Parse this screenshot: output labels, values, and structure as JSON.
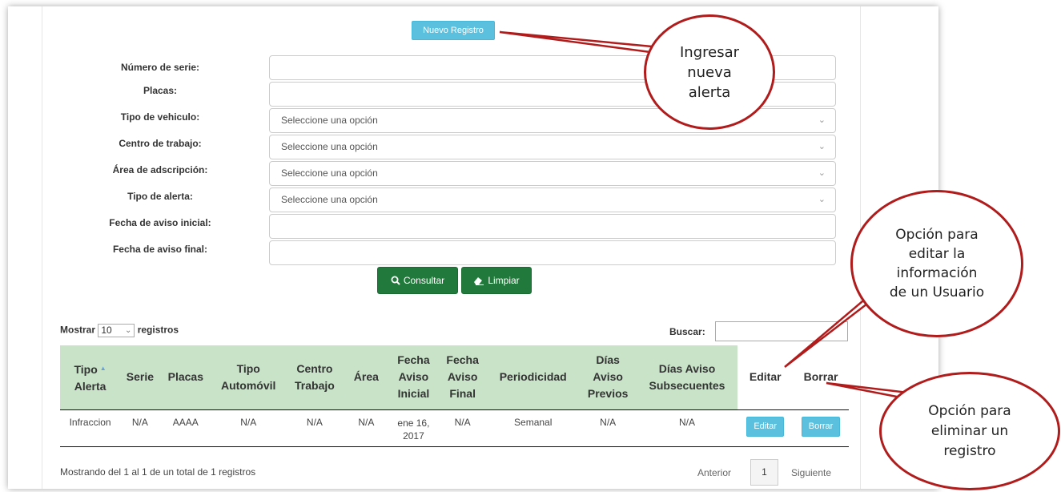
{
  "header": {
    "new_button": "Nuevo Registro"
  },
  "form": {
    "fields": [
      {
        "label": "Número de serie:",
        "type": "text",
        "value": ""
      },
      {
        "label": "Placas:",
        "type": "text",
        "value": ""
      },
      {
        "label": "Tipo de vehiculo:",
        "type": "select",
        "value": "Seleccione una opción"
      },
      {
        "label": "Centro de trabajo:",
        "type": "select",
        "value": "Seleccione una opción"
      },
      {
        "label": "Área de adscripción:",
        "type": "select",
        "value": "Seleccione una opción"
      },
      {
        "label": "Tipo de alerta:",
        "type": "select",
        "value": "Seleccione una opción"
      },
      {
        "label": "Fecha de aviso inicial:",
        "type": "text",
        "value": ""
      },
      {
        "label": "Fecha de aviso final:",
        "type": "text",
        "value": ""
      }
    ],
    "consult_label": "Consultar",
    "clear_label": "Limpiar"
  },
  "table_controls": {
    "show_prefix": "Mostrar",
    "length_value": "10",
    "show_suffix": "registros",
    "search_label": "Buscar:"
  },
  "table": {
    "columns": [
      [
        "Tipo",
        "Alerta"
      ],
      [
        "Serie"
      ],
      [
        "Placas"
      ],
      [
        "Tipo",
        "Automóvil"
      ],
      [
        "Centro",
        "Trabajo"
      ],
      [
        "Área"
      ],
      [
        "Fecha",
        "Aviso",
        "Inicial"
      ],
      [
        "Fecha",
        "Aviso",
        "Final"
      ],
      [
        "Periodicidad"
      ],
      [
        "Días",
        "Aviso",
        "Previos"
      ],
      [
        "Días Aviso",
        "Subsecuentes"
      ],
      [
        "Editar"
      ],
      [
        "Borrar"
      ]
    ],
    "rows": [
      {
        "tipo_alerta": "Infraccion",
        "serie": "N/A",
        "placas": "AAAA",
        "tipo_automovil": "N/A",
        "centro_trabajo": "N/A",
        "area": "N/A",
        "fecha_inicial": [
          "ene 16,",
          "2017"
        ],
        "fecha_final": "N/A",
        "periodicidad": "Semanal",
        "dias_previos": "N/A",
        "dias_subsecuentes": "N/A",
        "edit_label": "Editar",
        "delete_label": "Borrar"
      }
    ],
    "header_color": "#c9e3c9"
  },
  "footer": {
    "info": "Mostrando del 1 al 1 de un total de 1 registros",
    "prev": "Anterior",
    "page": "1",
    "next": "Siguiente"
  },
  "annotations": {
    "new_alert": [
      "Ingresar",
      "nueva",
      "alerta"
    ],
    "edit_user": [
      "Opción para",
      "editar la",
      "información",
      "de un Usuario"
    ],
    "delete_record": [
      "Opción para",
      "eliminar un",
      "registro"
    ],
    "accent_color": "#b01c1c"
  }
}
